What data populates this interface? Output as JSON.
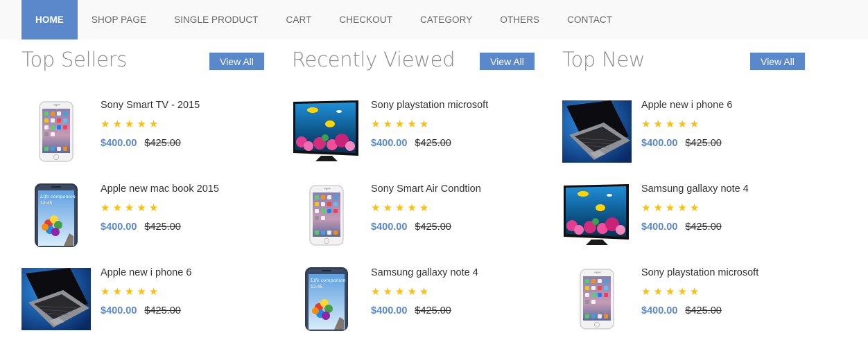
{
  "nav": {
    "items": [
      "Home",
      "Shop page",
      "Single product",
      "Cart",
      "Checkout",
      "Category",
      "Others",
      "Contact"
    ],
    "active": "Home"
  },
  "colors": {
    "accent": "#5a88ca",
    "star": "#fcc00c",
    "nav_bg": "#f9f9f9",
    "title": "#8c8c8c"
  },
  "columns": [
    {
      "title": "Top Sellers",
      "view_all": "View All",
      "products": [
        {
          "name": "Sony Smart TV - 2015",
          "image": "iphone-image",
          "rating": 5,
          "price": "$400.00",
          "old_price": "$425.00"
        },
        {
          "name": "Apple new mac book 2015",
          "image": "galaxy-phone-image",
          "rating": 5,
          "price": "$400.00",
          "old_price": "$425.00"
        },
        {
          "name": "Apple new i phone 6",
          "image": "laptop-image",
          "rating": 5,
          "price": "$400.00",
          "old_price": "$425.00"
        }
      ]
    },
    {
      "title": "Recently Viewed",
      "view_all": "View All",
      "products": [
        {
          "name": "Sony playstation microsoft",
          "image": "tv-image",
          "rating": 5,
          "price": "$400.00",
          "old_price": "$425.00"
        },
        {
          "name": "Sony Smart Air Condtion",
          "image": "iphone-image",
          "rating": 5,
          "price": "$400.00",
          "old_price": "$425.00"
        },
        {
          "name": "Samsung gallaxy note 4",
          "image": "galaxy-phone-image",
          "rating": 5,
          "price": "$400.00",
          "old_price": "$425.00"
        }
      ]
    },
    {
      "title": "Top New",
      "view_all": "View All",
      "products": [
        {
          "name": "Apple new i phone 6",
          "image": "laptop-image",
          "rating": 5,
          "price": "$400.00",
          "old_price": "$425.00"
        },
        {
          "name": "Samsung gallaxy note 4",
          "image": "tv-image",
          "rating": 5,
          "price": "$400.00",
          "old_price": "$425.00"
        },
        {
          "name": "Sony playstation microsoft",
          "image": "iphone-image",
          "rating": 5,
          "price": "$400.00",
          "old_price": "$425.00"
        }
      ]
    }
  ],
  "galaxy_screen_text": {
    "line1": "Life companion",
    "time": "12:45"
  }
}
